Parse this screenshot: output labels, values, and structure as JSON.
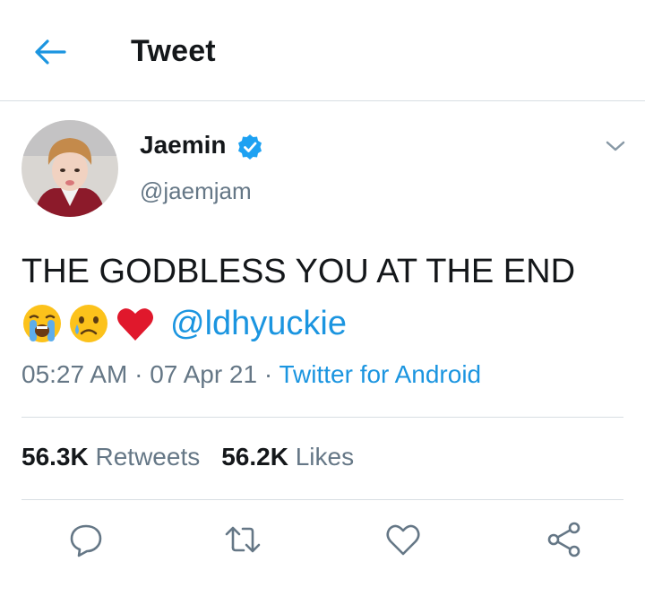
{
  "header": {
    "title": "Tweet"
  },
  "tweet": {
    "author": {
      "name": "Jaemin",
      "handle": "@jaemjam",
      "verified": true
    },
    "text_line1": "THE GODBLESS YOU AT THE END",
    "emojis": [
      "loudly-crying-face",
      "crying-face",
      "red-heart"
    ],
    "mention": "@ldhyuckie",
    "time": "05:27 AM",
    "separator1": " · ",
    "date": "07 Apr 21",
    "separator2": " · ",
    "source": "Twitter for Android",
    "retweets_count": "56.3K",
    "retweets_label": "Retweets",
    "likes_count": "56.2K",
    "likes_label": "Likes"
  },
  "actions": [
    "reply-icon",
    "retweet-icon",
    "like-icon",
    "share-icon"
  ],
  "colors": {
    "accent": "#1b95e0",
    "secondary_text": "#657786",
    "divider": "#d8dee3"
  }
}
